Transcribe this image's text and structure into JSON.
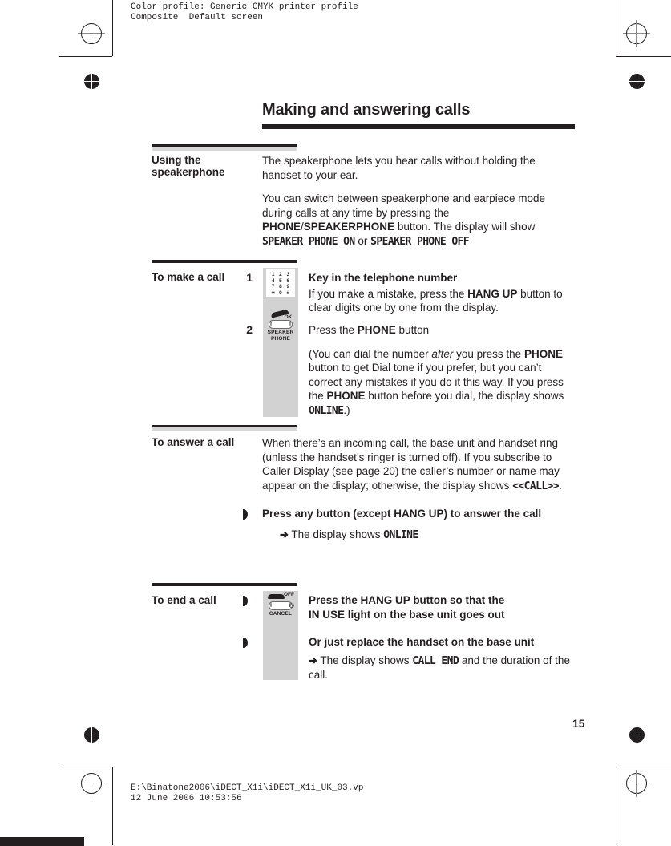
{
  "prepress": {
    "color_profile_note": "Color profile: Generic CMYK printer profile\nComposite  Default screen",
    "file_path_note": "E:\\Binatone2006\\iDECT_X1i\\iDECT_X1i_UK_03.vp\n12 June 2006 10:53:56"
  },
  "page": {
    "title": "Making and answering calls",
    "number": "15"
  },
  "sections": [
    {
      "label": "Using the speakerphone",
      "paragraphs": [
        "The speakerphone lets you hear calls without holding the handset to your ear.",
        "You can switch between speakerphone and earpiece mode during calls at any time by pressing the PHONE/SPEAKERPHONE button. The display will show SPEAKER PHONE ON or SPEAKER PHONE OFF"
      ],
      "bold_runs": [
        "PHONE",
        "SPEAKERPHONE"
      ],
      "lcd_strings": [
        "SPEAKER PHONE ON",
        "SPEAKER PHONE OFF"
      ]
    },
    {
      "label": "To make a call",
      "steps": [
        {
          "number": "1",
          "heading": "Key in the telephone number",
          "body": "If you make a mistake, press the HANG UP button to clear digits one by one from the display.",
          "bold_runs": [
            "HANG UP"
          ],
          "icon": "keypad-icon"
        },
        {
          "number": "2",
          "heading": "Press the PHONE button",
          "body": "(You can dial the number after you press the PHONE button to get Dial tone if you prefer, but you can't correct any mistakes if you do it this way. If you press the PHONE button before you dial, the display shows ONLINE.)",
          "bold_runs": [
            "PHONE"
          ],
          "italic_runs": [
            "after"
          ],
          "lcd_strings": [
            "ONLINE"
          ],
          "icon": "speakerphone-button-icon"
        }
      ]
    },
    {
      "label": "To answer a call",
      "intro": "When there's an incoming call, the base unit and handset ring (unless the handset's ringer is turned off). If you subscribe to Caller Display (see page 20) the caller's number or name may appear on the display; otherwise, the display shows <<CALL>>.",
      "intro_lcd": "<<CALL>>",
      "bullets": [
        {
          "heading": "Press any button (except HANG UP) to answer the call",
          "bold_runs": [
            "HANG UP"
          ],
          "result_arrow": "➔",
          "result_text": "The display shows",
          "result_lcd": "ONLINE"
        }
      ]
    },
    {
      "label": "To end a call",
      "bullets": [
        {
          "heading": "Press the HANG UP button so that the IN USE light on the base unit goes out",
          "bold_runs": [
            "HANG UP"
          ],
          "icon": "hangup-button-icon"
        },
        {
          "heading": "Or just replace the handset on the base unit",
          "result_arrow": "➔",
          "result_text_prefix": "The display shows",
          "result_lcd": "CALL END",
          "result_text_suffix": "and the duration of the call."
        }
      ]
    }
  ],
  "icons": {
    "keypad": {
      "name": "keypad-icon",
      "rows": [
        [
          "1",
          "2",
          "3"
        ],
        [
          "4",
          "5",
          "6"
        ],
        [
          "7",
          "8",
          "9"
        ],
        [
          "∗",
          "0",
          "#"
        ]
      ]
    },
    "speakerphone_button": {
      "name": "speakerphone-button-icon",
      "ok_label": "OK",
      "caption_line1": "SPEAKER",
      "caption_line2": "PHONE"
    },
    "hangup_button": {
      "name": "hangup-button-icon",
      "off_label": "OFF",
      "power_symbol": "⏻",
      "caption": "CANCEL"
    }
  },
  "colors": {
    "ink": "#231f20",
    "art_strip": "#d2d2d2",
    "rule_gray": "#d6d6d6"
  }
}
